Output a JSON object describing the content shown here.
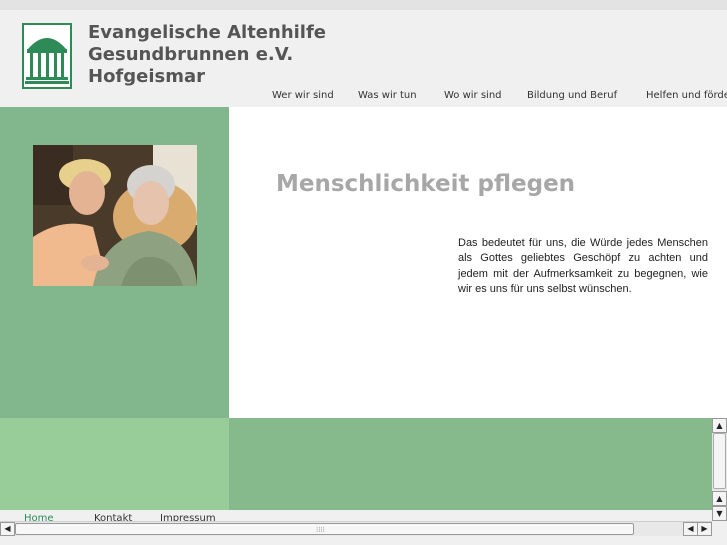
{
  "header": {
    "org_name": [
      "Evangelische Altenhilfe",
      "Gesundbrunnen e.V.",
      "Hofgeismar"
    ]
  },
  "nav": {
    "items": [
      {
        "label": "Wer wir sind"
      },
      {
        "label": "Was wir tun"
      },
      {
        "label": "Wo wir sind"
      },
      {
        "label": "Bildung und Beruf"
      },
      {
        "label": "Helfen und förde"
      }
    ]
  },
  "main": {
    "headline": "Menschlichkeit pflegen",
    "intro": "Das bedeutet für uns, die Würde jedes Menschen als Gottes geliebtes Geschöpf zu achten und jedem mit der Aufmerksamkeit zu begegnen, wie wir es uns für uns selbst wünschen."
  },
  "footer": {
    "links": [
      {
        "label": "Home"
      },
      {
        "label": "Kontakt"
      },
      {
        "label": "Impressum"
      }
    ]
  },
  "colors": {
    "brand_green": "#2e8b57",
    "sidebar_green": "#82b68c",
    "footer_green_light": "#98cc98",
    "footer_green": "#86b98c",
    "headline_gray": "#a7a7a7"
  },
  "icons": {
    "logo": "gazebo-logo-icon",
    "scroll_up": "arrow-up-icon",
    "scroll_down": "arrow-down-icon",
    "scroll_left": "arrow-left-icon",
    "scroll_right": "arrow-right-icon"
  }
}
